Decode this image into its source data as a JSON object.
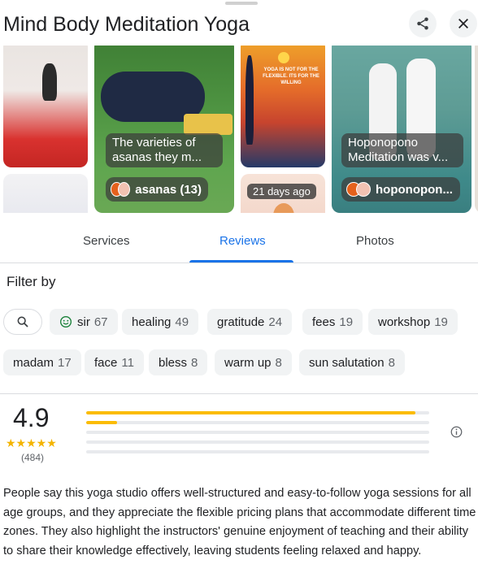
{
  "header": {
    "title": "Mind Body Meditation Yoga",
    "share_icon": "share-icon",
    "close_icon": "close-icon"
  },
  "gallery": {
    "poster_text": "YOGA IS NOT FOR THE FLEXIBLE. ITS FOR THE WILLING",
    "post1": {
      "caption": "The varieties of asanas they m...",
      "author": "asanas (13)"
    },
    "post2": {
      "age": "21 days ago"
    },
    "post3": {
      "caption": "Hoponopono Meditation was v...",
      "author": "hoponopon..."
    }
  },
  "tabs": [
    {
      "label": "Services"
    },
    {
      "label": "Reviews",
      "active": true
    },
    {
      "label": "Photos"
    }
  ],
  "filter": {
    "label": "Filter by",
    "search_icon": "search-icon",
    "chips": [
      {
        "label": "sir",
        "count": "67",
        "icon": "smiley-icon"
      },
      {
        "label": "healing",
        "count": "49"
      },
      {
        "label": "gratitude",
        "count": "24"
      },
      {
        "label": "fees",
        "count": "19"
      },
      {
        "label": "workshop",
        "count": "19"
      },
      {
        "label": "madam",
        "count": "17"
      },
      {
        "label": "face",
        "count": "11"
      },
      {
        "label": "bless",
        "count": "8"
      },
      {
        "label": "warm up",
        "count": "8"
      },
      {
        "label": "sun salutation",
        "count": "8"
      }
    ]
  },
  "rating": {
    "score": "4.9",
    "stars": "★★★★★",
    "count": "(484)",
    "distribution": [
      {
        "stars": 5,
        "fraction": 0.96
      },
      {
        "stars": 4,
        "fraction": 0.09
      },
      {
        "stars": 3,
        "fraction": 0.0
      },
      {
        "stars": 2,
        "fraction": 0.0
      },
      {
        "stars": 1,
        "fraction": 0.0
      }
    ],
    "bar_color": "#fbbc04",
    "info_icon": "info-icon"
  },
  "summary": "People say this yoga studio offers well-structured and easy-to-follow yoga sessions for all age groups, and they appreciate the flexible pricing plans that accommodate different time zones. They also highlight the instructors' genuine enjoyment of teaching and their ability to share their knowledge effectively, leaving students feeling relaxed and happy.",
  "colors": {
    "accent": "#1a73e8",
    "star": "#f4b400"
  }
}
